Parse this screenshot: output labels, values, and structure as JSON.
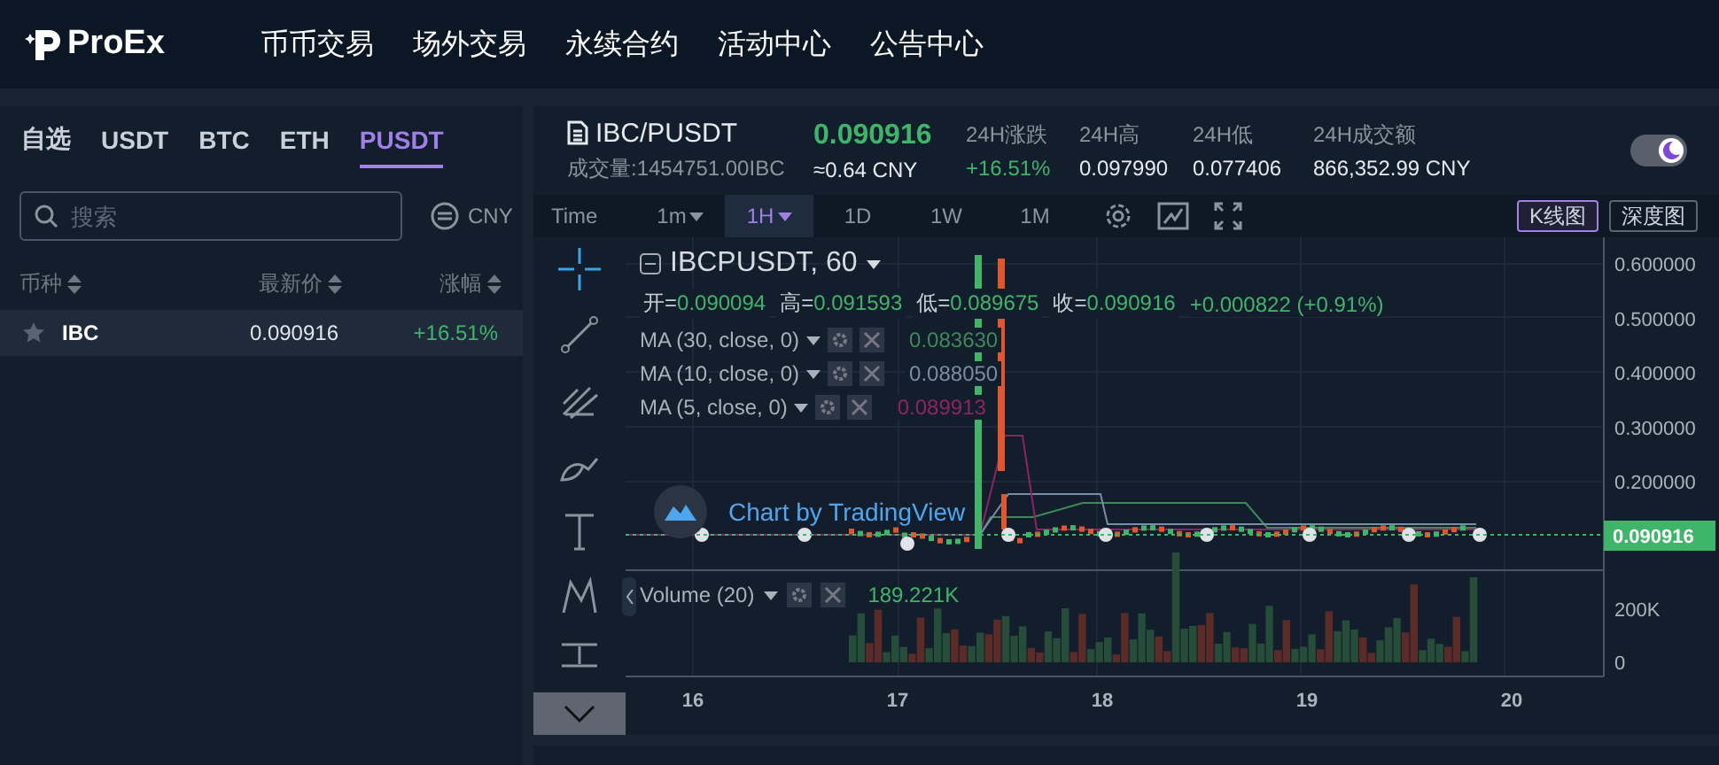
{
  "header": {
    "logo": "ProEx",
    "nav": [
      {
        "label": "币币交易"
      },
      {
        "label": "场外交易"
      },
      {
        "label": "永续合约"
      },
      {
        "label": "活动中心"
      },
      {
        "label": "公告中心"
      }
    ]
  },
  "market": {
    "tabs": [
      {
        "label": "自选",
        "selected": false
      },
      {
        "label": "USDT",
        "selected": false
      },
      {
        "label": "BTC",
        "selected": false
      },
      {
        "label": "ETH",
        "selected": false
      },
      {
        "label": "PUSDT",
        "selected": true
      }
    ],
    "search": {
      "placeholder": "搜索"
    },
    "currency": "CNY",
    "columns": [
      "币种",
      "最新价",
      "涨幅"
    ],
    "rows": [
      {
        "symbol": "IBC",
        "price": "0.090916",
        "change": "+16.51%",
        "selected": true
      }
    ]
  },
  "ticker": {
    "pair": "IBC/PUSDT",
    "price": "0.090916",
    "volume": "成交量:1454751.00IBC",
    "price_cny": "≈0.64 CNY",
    "dark_mode": true,
    "stats": [
      {
        "label": "24H涨跌",
        "value": "+16.51%",
        "kind": "change"
      },
      {
        "label": "24H高",
        "value": "0.097990",
        "kind": "plain"
      },
      {
        "label": "24H低",
        "value": "0.077406",
        "kind": "plain"
      },
      {
        "label": "24H成交额",
        "value": "866,352.99 CNY",
        "kind": "plain"
      }
    ]
  },
  "toolbar": {
    "label": "Time",
    "intervals": [
      {
        "label": "1m",
        "dropdown": true,
        "selected": false
      },
      {
        "label": "1H",
        "dropdown": true,
        "selected": true
      },
      {
        "label": "1D",
        "dropdown": false,
        "selected": false
      },
      {
        "label": "1W",
        "dropdown": false,
        "selected": false
      },
      {
        "label": "1M",
        "dropdown": false,
        "selected": false
      }
    ],
    "views": [
      {
        "label": "K线图",
        "selected": true
      },
      {
        "label": "深度图",
        "selected": false
      }
    ]
  },
  "chart": {
    "symbol": "IBCPUSDT, 60",
    "ohlc": [
      {
        "label": "开=",
        "value": "0.090094"
      },
      {
        "label": "高=",
        "value": "0.091593"
      },
      {
        "label": "低=",
        "value": "0.089675"
      },
      {
        "label": "收=",
        "value": "0.090916"
      }
    ],
    "change": "+0.000822 (+0.91%)",
    "indicators": [
      {
        "name": "MA (30, close, 0)",
        "value": "0.083630",
        "color": "#3d8a58"
      },
      {
        "name": "MA (10, close, 0)",
        "value": "0.088050",
        "color": "#7a8ca6"
      },
      {
        "name": "MA (5, close, 0)",
        "value": "0.089913",
        "color": "#8e2466"
      }
    ],
    "attribution": "Chart by TradingView",
    "price_ticks": [
      "0.600000",
      "0.500000",
      "0.400000",
      "0.300000",
      "0.200000"
    ],
    "last_price": "0.090916",
    "volume": {
      "name": "Volume (20)",
      "value": "189.221K",
      "ticks": [
        "200K",
        "0"
      ]
    },
    "date_ticks": [
      "16",
      "17",
      "18",
      "19",
      "20"
    ]
  }
}
